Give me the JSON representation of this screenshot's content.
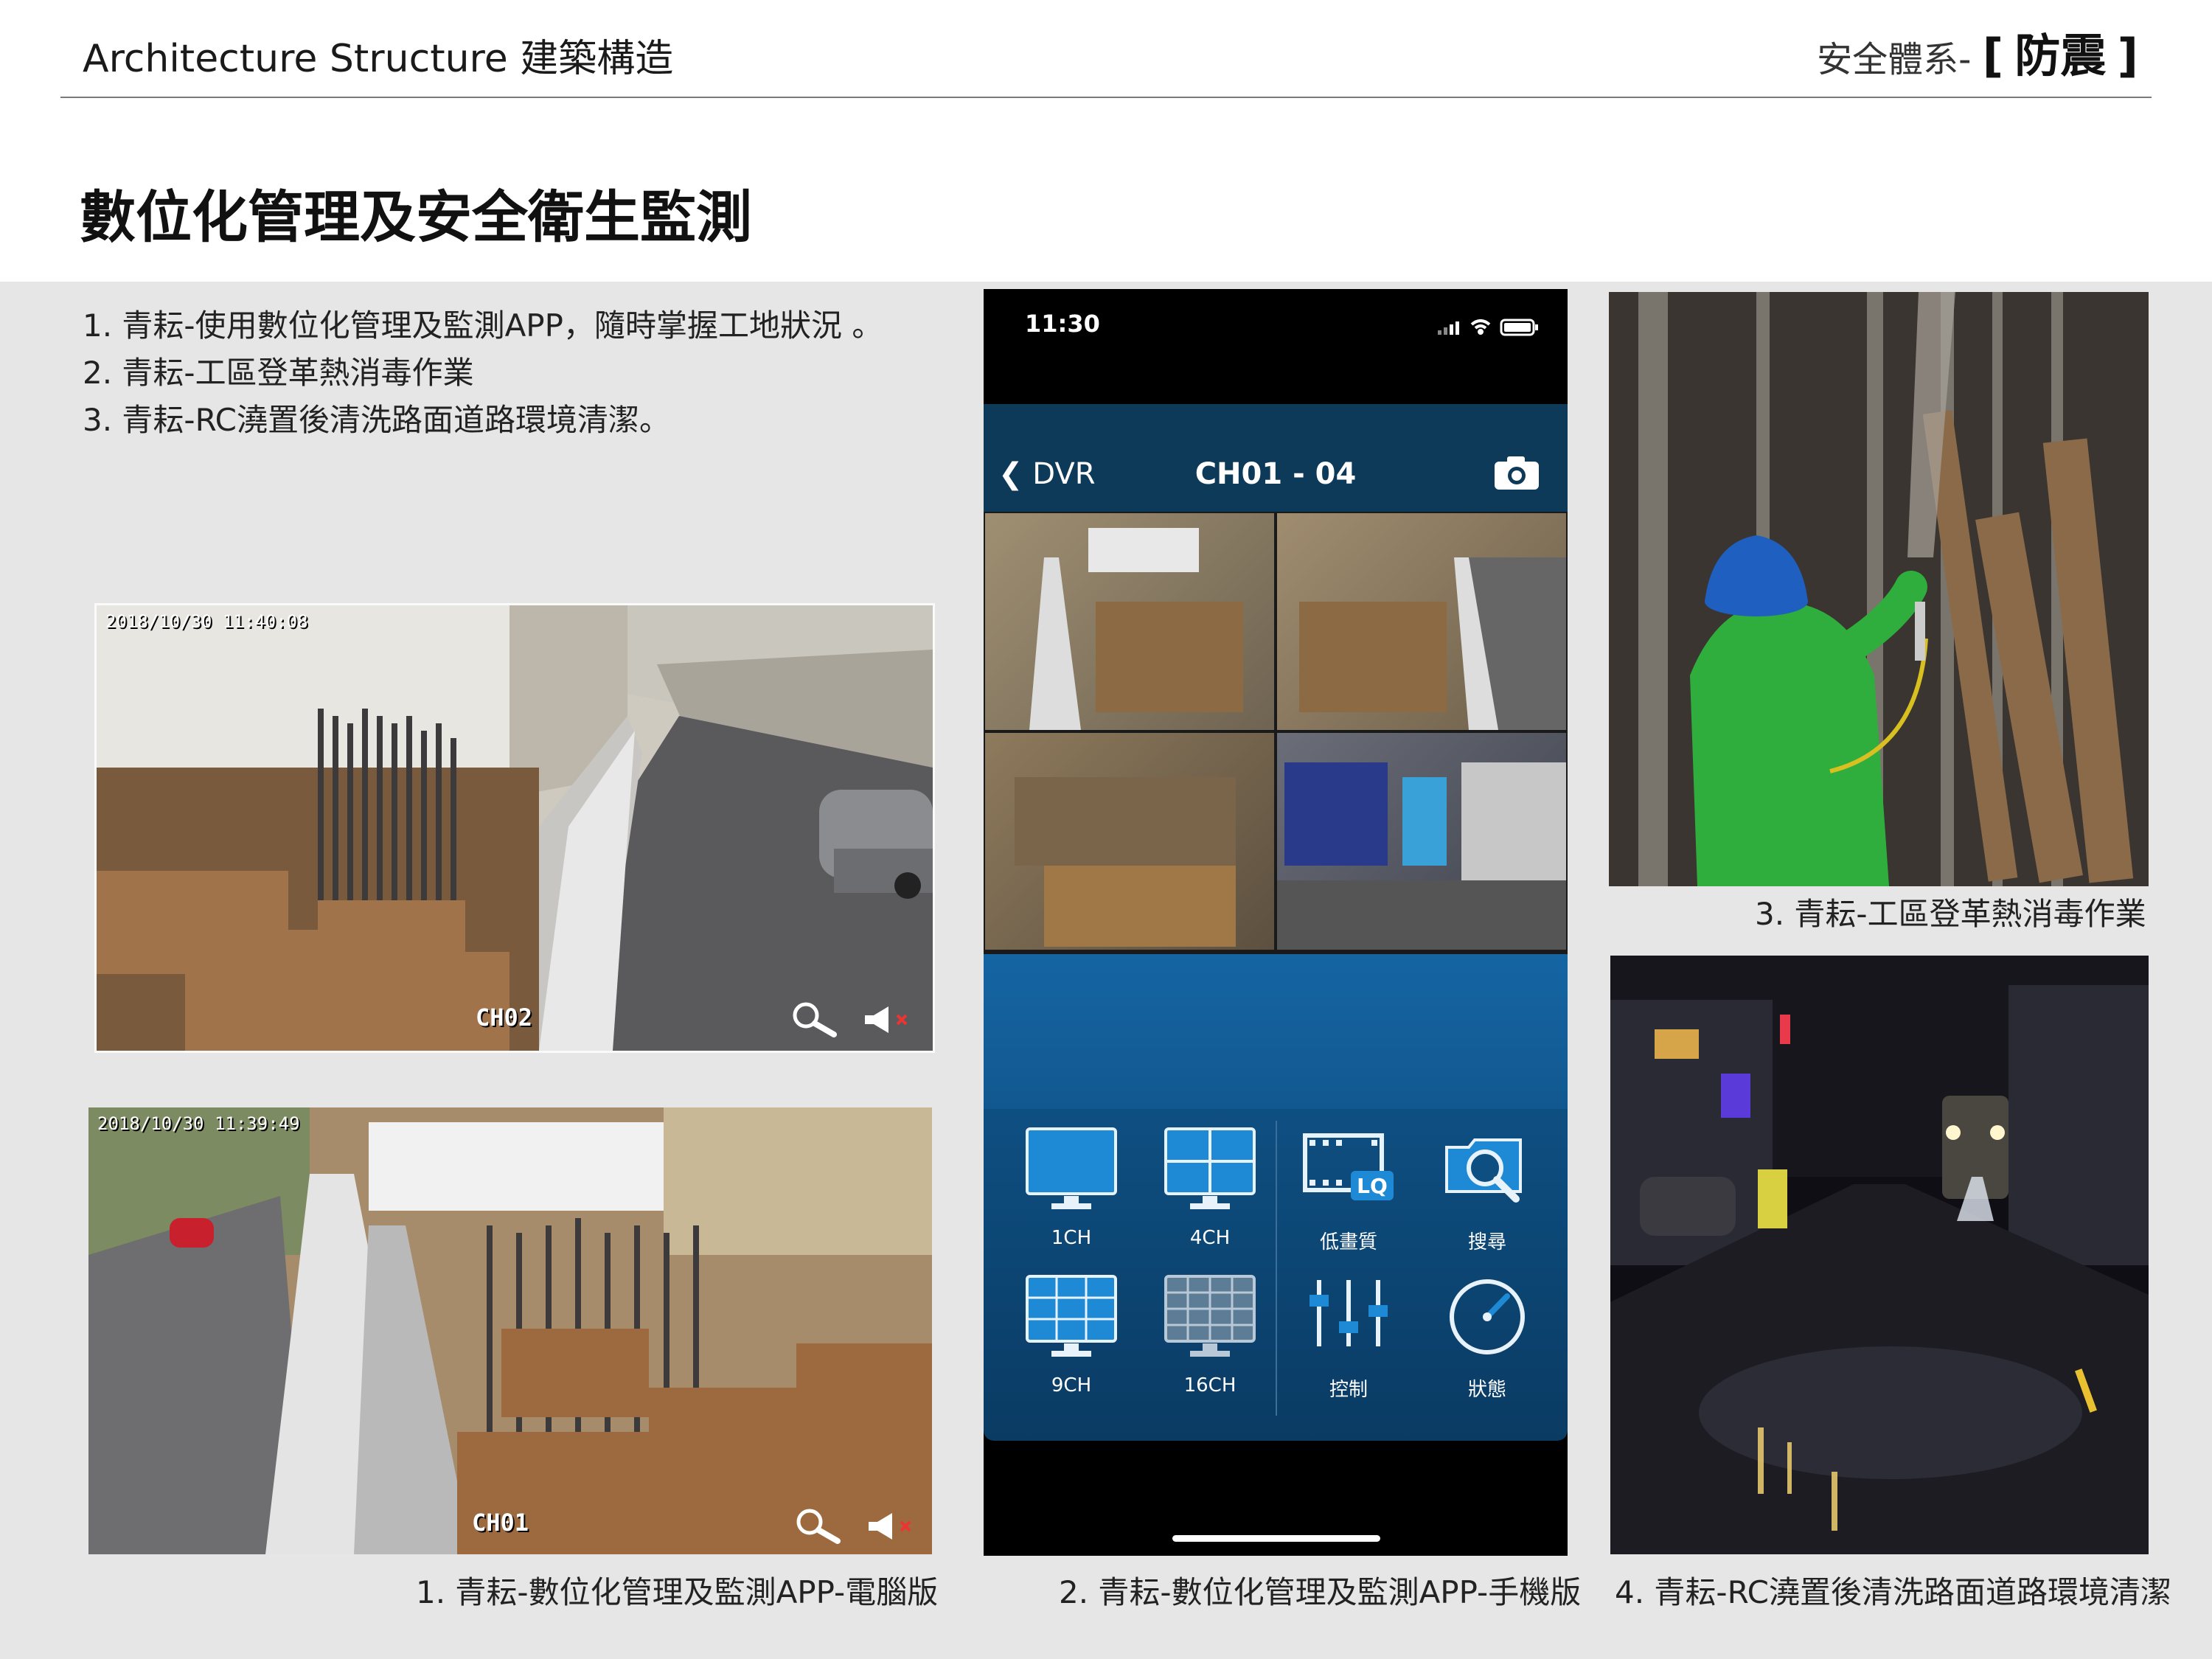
{
  "header": {
    "left_title": "Architecture Structure 建築構造",
    "right_prefix": "安全體系-",
    "right_bracket_open": "[",
    "right_highlight": "防震",
    "right_bracket_close": "]"
  },
  "page_title": "數位化管理及安全衛生監測",
  "notes": [
    "1. 青耘-使用數位化管理及監測APP，隨時掌握工地狀況 。",
    "2. 青耘-工區登革熱消毒作業",
    "3. 青耘-RC澆置後清洗路面道路環境清潔。"
  ],
  "pc_view_top": {
    "timestamp": "2018/10/30 11:40:08",
    "channel": "CH02"
  },
  "pc_view_bottom": {
    "timestamp": "2018/10/30 11:39:49",
    "channel": "CH01"
  },
  "phone": {
    "time": "11:30",
    "nav_back": "DVR",
    "nav_title": "CH01 - 04",
    "controls": [
      {
        "label": "1CH",
        "icon": "single-screen-icon"
      },
      {
        "label": "4CH",
        "icon": "quad-screen-icon"
      },
      {
        "label": "低畫質",
        "icon": "low-quality-film-icon"
      },
      {
        "label": "搜尋",
        "icon": "search-folder-icon"
      },
      {
        "label": "9CH",
        "icon": "nine-screen-icon"
      },
      {
        "label": "16CH",
        "icon": "sixteen-screen-icon"
      },
      {
        "label": "控制",
        "icon": "sliders-icon"
      },
      {
        "label": "狀態",
        "icon": "gauge-icon"
      }
    ]
  },
  "captions": {
    "pc": "1. 青耘-數位化管理及監測APP-電腦版",
    "phone": "2. 青耘-數位化管理及監測APP-手機版",
    "disinfection": "3. 青耘-工區登革熱消毒作業",
    "cleaning": "4. 青耘-RC澆置後清洗路面道路環境清潔"
  },
  "colors": {
    "panel_bg": "#e6e6e6",
    "phone_blue": "#1565a3",
    "nav_bg": "#0e3a5a"
  }
}
